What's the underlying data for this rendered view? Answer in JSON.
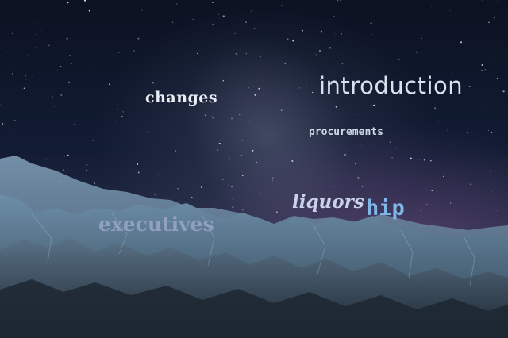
{
  "image": {
    "scene": "night sky over a glacier / ice field",
    "words": {
      "changes": "changes",
      "introduction": "introduction",
      "procurements": "procurements",
      "liquors": "liquors",
      "hip": "hip",
      "executives": "executives"
    }
  }
}
